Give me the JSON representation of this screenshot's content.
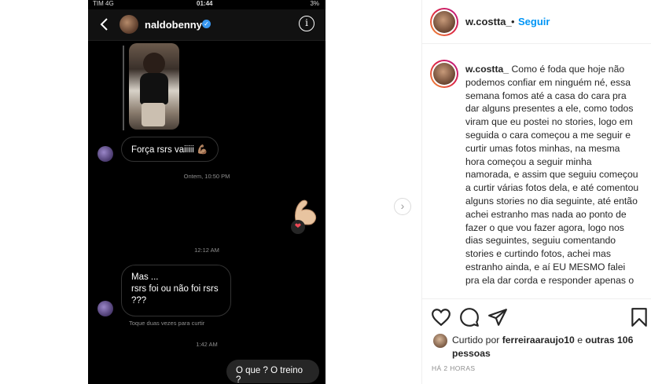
{
  "phone": {
    "status": {
      "carrier": "TIM  4G",
      "time": "01:44",
      "battery": "3%"
    },
    "header": {
      "username": "naldobenny",
      "verified_mark": "✓",
      "info_label": "i"
    },
    "messages": {
      "incoming_1": "Força rsrs vaiiiii 💪🏽",
      "timestamp_1": "Ontem, 10:50 PM",
      "timestamp_2": "12:12 AM",
      "incoming_2_lines": [
        "Mas ...",
        "rsrs foi ou não foi rsrs",
        "???"
      ],
      "tap_hint": "Toque duas vezes para curtir",
      "timestamp_3": "1:42 AM",
      "outgoing_1": "O que ? O treino ?"
    },
    "reaction_heart": "❤"
  },
  "carousel": {
    "next_label": "›"
  },
  "post": {
    "header": {
      "username": "w.costta_",
      "separator": "•",
      "follow_label": "Seguir"
    },
    "caption": {
      "username": "w.costta_",
      "text": "Como é foda que hoje não podemos confiar em ninguém né, essa semana fomos até a casa do cara pra dar alguns presentes a ele, como todos viram que eu postei no stories, logo em seguida o cara começou a me seguir e curtir umas fotos minhas, na mesma hora começou a seguir minha namorada, e assim que seguiu começou a curtir várias fotos dela, e até comentou alguns stories no dia seguinte, até então achei estranho mas nada ao ponto de fazer o que vou fazer agora, logo nos dias seguintes, seguiu comentando stories e curtindo fotos, achei mas estranho ainda, e aí EU MESMO falei pra ela dar corda e responder apenas o"
    },
    "likes": {
      "prefix": "Curtido por ",
      "user": "ferreiraaraujo10",
      "mid": " e ",
      "others": "outras 106 pessoas"
    },
    "time_ago": "HÁ 2 HORAS"
  },
  "icons": [
    "back-icon",
    "info-icon",
    "verified-icon",
    "heart-icon",
    "comment-icon",
    "share-icon",
    "bookmark-icon",
    "chevron-right-icon"
  ],
  "colors": {
    "accent": "#0095f6",
    "verified": "#3897f0",
    "text": "#262626",
    "muted": "#8e8e8e"
  }
}
